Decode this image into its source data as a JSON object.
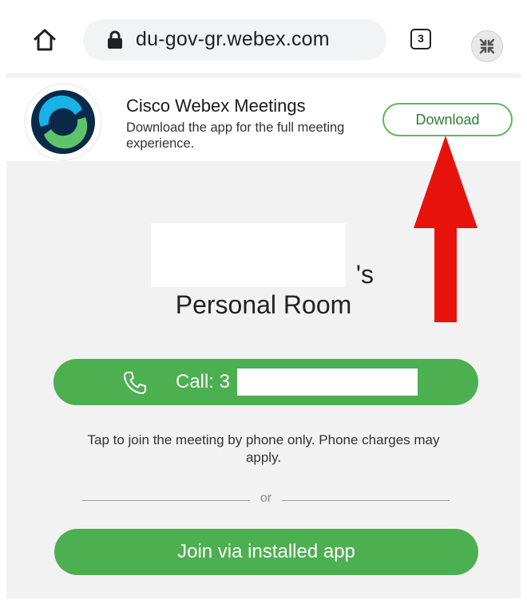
{
  "browser": {
    "url": "du-gov-gr.webex.com",
    "tab_count": "3"
  },
  "app_banner": {
    "title": "Cisco Webex Meetings",
    "description": "Download the app for the full meeting experience.",
    "download_label": "Download"
  },
  "meeting": {
    "title_tail": "'s",
    "room_title": "Personal Room",
    "call_label": "Call: 3",
    "call_note": "Tap to join the meeting by phone only. Phone charges may apply.",
    "or_text": "or",
    "join_label": "Join via installed app"
  },
  "colors": {
    "accent_green": "#4caf50",
    "annotation_red": "#e8120c"
  },
  "icons": {
    "home": "home-icon",
    "lock": "lock-icon",
    "tabs": "tab-count-icon",
    "extension": "shrink-arrows-icon",
    "logo": "webex-logo-icon",
    "phone": "phone-icon"
  }
}
